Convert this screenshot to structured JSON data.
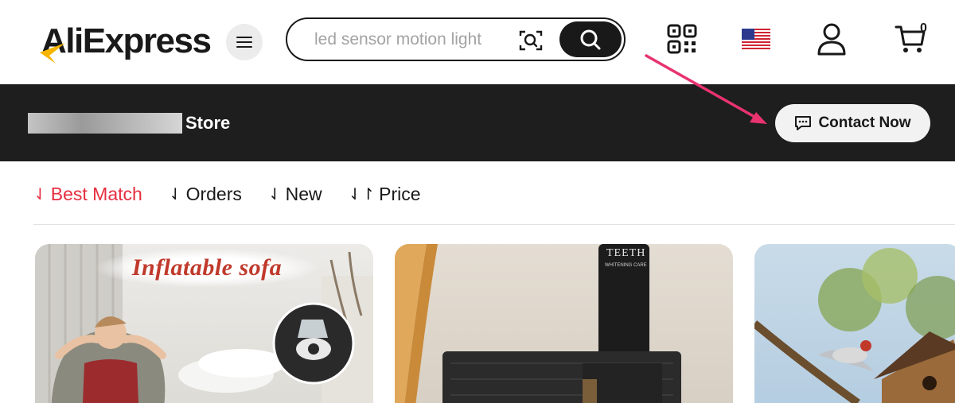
{
  "header": {
    "logo_text": "AliExpress",
    "search_placeholder": "led sensor motion light",
    "cart_count": "0"
  },
  "store_bar": {
    "store_label": "Store",
    "contact_label": "Contact Now"
  },
  "sort": {
    "items": [
      {
        "label": "Best Match",
        "arrow": "⇃",
        "active": true
      },
      {
        "label": "Orders",
        "arrow": "⇃",
        "active": false
      },
      {
        "label": "New",
        "arrow": "⇃",
        "active": false
      },
      {
        "label": "Price",
        "arrow": "⇃↾",
        "active": false
      }
    ]
  },
  "products": [
    {
      "banner": "Inflatable sofa"
    },
    {
      "tube_text": "TEETH",
      "tube_sub": "WHITENING CARE"
    },
    {}
  ],
  "colors": {
    "accent_red": "#e62e3f",
    "dark_bar": "#1e1e1e",
    "annotation_arrow": "#e8336f"
  },
  "icons": [
    "menu-icon",
    "camera-search-icon",
    "search-icon",
    "qr-code-icon",
    "us-flag-icon",
    "user-icon",
    "cart-icon",
    "chat-icon"
  ]
}
